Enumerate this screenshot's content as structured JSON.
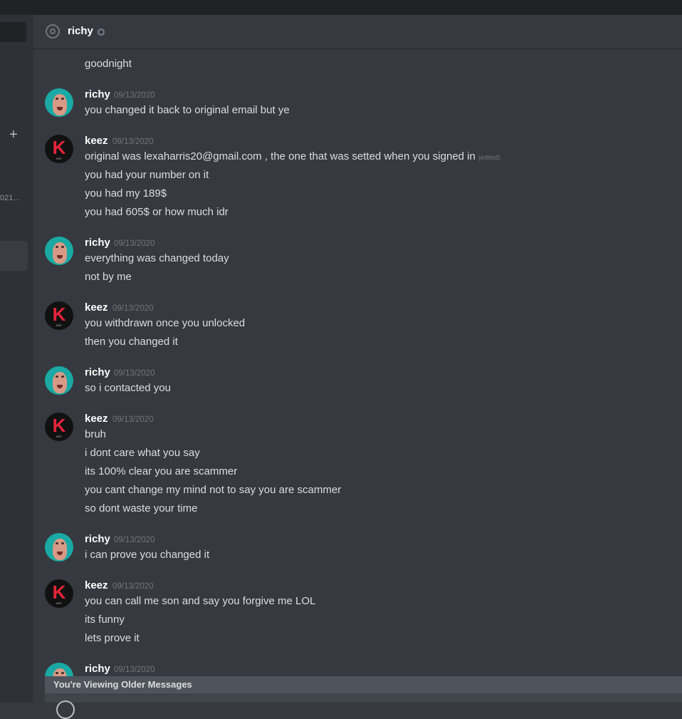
{
  "sidebar": {
    "plus": "+",
    "truncated_label": "021..."
  },
  "header": {
    "name": "richy"
  },
  "messages": [
    {
      "lines": [
        "goodnight"
      ]
    },
    {
      "author": "richy",
      "timestamp": "09/13/2020",
      "lines": [
        "you changed it back to original email but ye"
      ]
    },
    {
      "author": "keez",
      "timestamp": "09/13/2020",
      "lines": [
        "original was lexaharris20@gmail.com , the one that was setted when you signed in",
        "you had your number on it",
        "you had my 189$",
        "you had 605$ or how much idr"
      ],
      "edited_label": "(edited)"
    },
    {
      "author": "richy",
      "timestamp": "09/13/2020",
      "lines": [
        "everything was changed today",
        "not by me"
      ]
    },
    {
      "author": "keez",
      "timestamp": "09/13/2020",
      "lines": [
        "you withdrawn once you unlocked",
        "then you changed it"
      ]
    },
    {
      "author": "richy",
      "timestamp": "09/13/2020",
      "lines": [
        "so i contacted you"
      ]
    },
    {
      "author": "keez",
      "timestamp": "09/13/2020",
      "lines": [
        "bruh",
        "i dont care what you say",
        "its 100% clear you are scammer",
        "you cant change my mind not to say you are scammer",
        "so dont waste your time"
      ]
    },
    {
      "author": "richy",
      "timestamp": "09/13/2020",
      "lines": [
        "i can prove you changed it"
      ]
    },
    {
      "author": "keez",
      "timestamp": "09/13/2020",
      "lines": [
        "you can call me son and say you forgive me LOL",
        "its funny",
        "lets prove it"
      ]
    },
    {
      "author": "richy",
      "timestamp": "09/13/2020",
      "lines": []
    }
  ],
  "older_messages_banner": "You're Viewing Older Messages",
  "avatar_icons": {
    "richy": "face-avatar",
    "keez": "k-logo-avatar",
    "keez_letter": "K",
    "keez_small": "KST"
  },
  "colors": {
    "background": "#36393f",
    "sidebar": "#2f3136",
    "banner": "#4f545c",
    "keez_red": "#e6243a",
    "richy_teal": "#1aa9a4"
  }
}
